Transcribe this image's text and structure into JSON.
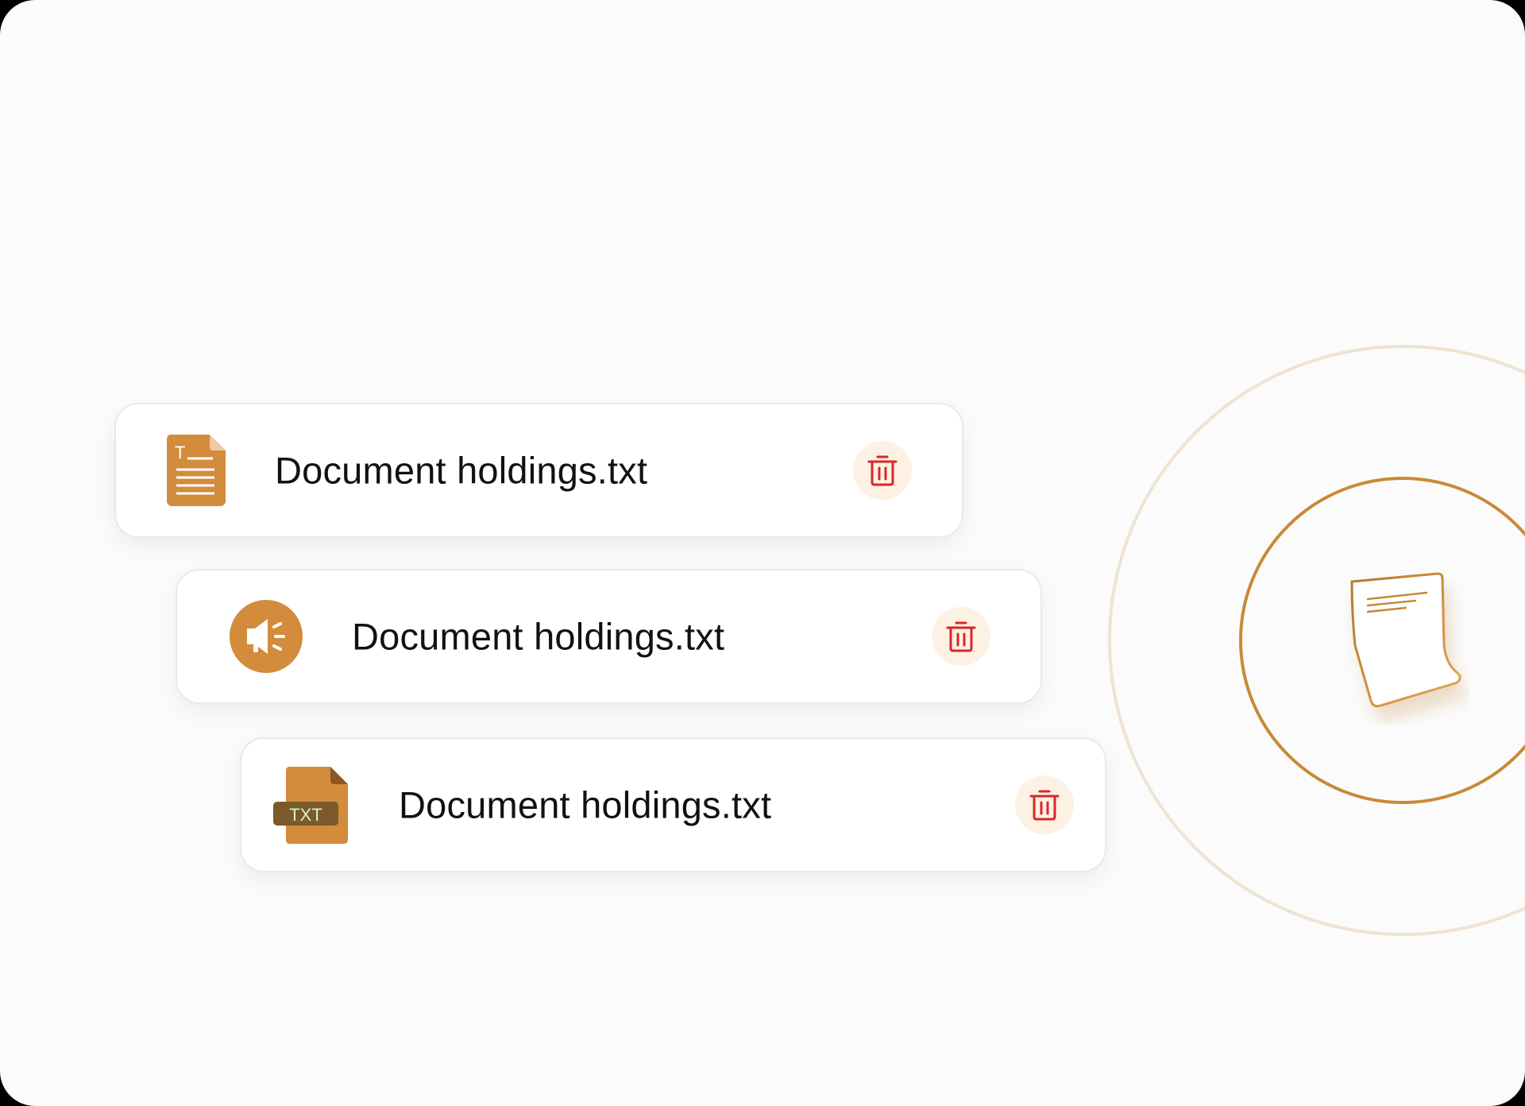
{
  "colors": {
    "accent": "#d38b3c",
    "delete": "#d9262b",
    "delete_bg": "#fdf1e3",
    "ring_outer": "#efe3d2",
    "ring_inner": "#c98a36"
  },
  "files": [
    {
      "name": "Document holdings.txt",
      "icon": "text-document-icon"
    },
    {
      "name": "Document holdings.txt",
      "icon": "audio-speaker-icon"
    },
    {
      "name": "Document holdings.txt",
      "icon": "txt-file-icon",
      "badge": "TXT"
    }
  ],
  "actions": {
    "delete_icon": "trash-icon"
  },
  "illustration": {
    "icon": "paper-document-icon"
  }
}
